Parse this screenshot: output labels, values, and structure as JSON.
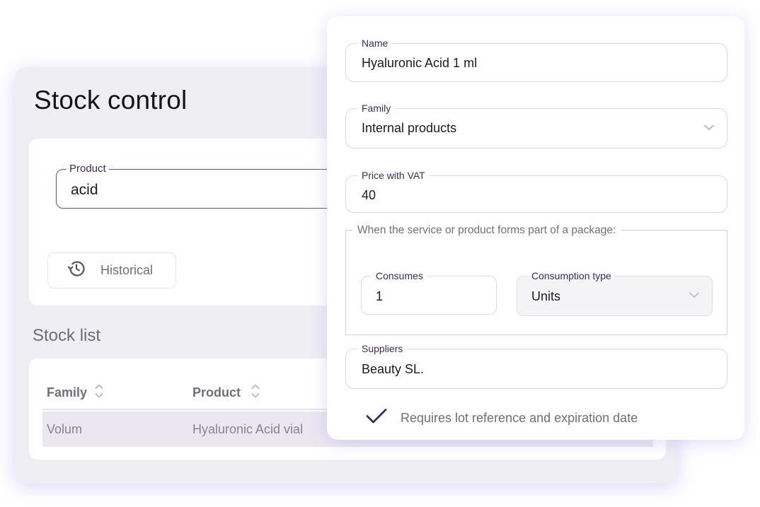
{
  "stock_control": {
    "title": "Stock control",
    "filter": {
      "product_label": "Product",
      "product_value": "acid"
    },
    "historical_button": {
      "label": "Historical",
      "icon": "history-icon"
    },
    "stock_list": {
      "title": "Stock list",
      "columns": [
        {
          "label": "Family",
          "sort_icon": "sort-icon"
        },
        {
          "label": "Product",
          "sort_icon": "sort-icon"
        }
      ],
      "rows": [
        {
          "family": "Volum",
          "product": "Hyaluronic Acid vial"
        }
      ]
    }
  },
  "product_form": {
    "name": {
      "label": "Name",
      "value": "Hyaluronic Acid 1 ml"
    },
    "family": {
      "label": "Family",
      "value": "Internal products",
      "icon": "chevron-down-icon"
    },
    "price": {
      "label": "Price with VAT",
      "value": "40"
    },
    "package": {
      "legend": "When the service or product forms part of a package:",
      "consumes": {
        "label": "Consumes",
        "value": "1"
      },
      "consumption_type": {
        "label": "Consumption type",
        "value": "Units",
        "icon": "chevron-down-icon"
      }
    },
    "suppliers": {
      "label": "Suppliers",
      "value": "Beauty SL."
    },
    "lot_checkbox": {
      "label": "Requires lot reference and expiration date",
      "checked": true,
      "icon": "check-icon"
    }
  },
  "colors": {
    "accent": "#3c2a63",
    "focus_border": "#6d4a8f",
    "panel_bg": "#efeef3",
    "selected_row": "#ebe7f1",
    "glow": "#968cf0"
  }
}
